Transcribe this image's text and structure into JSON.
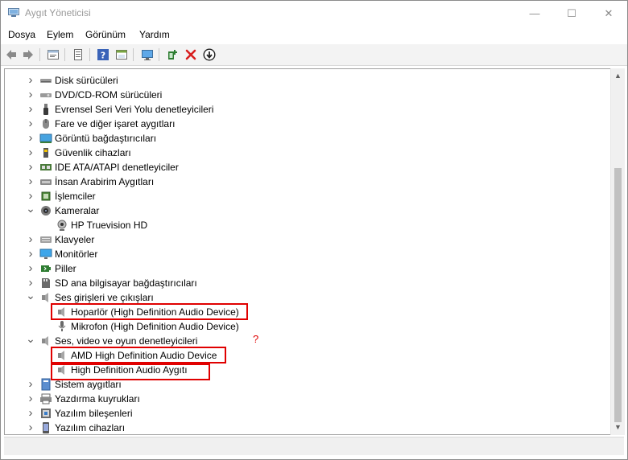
{
  "window": {
    "title": "Aygıt Yöneticisi"
  },
  "title_buttons": {
    "minimize": "—",
    "maximize": "☐",
    "close": "✕"
  },
  "menu": [
    "Dosya",
    "Eylem",
    "Görünüm",
    "Yardım"
  ],
  "toolbar": [
    "back-icon",
    "forward-icon",
    "properties-icon",
    "update-driver-icon",
    "help-icon",
    "view-icon",
    "monitor-icon",
    "add-driver-icon",
    "uninstall-icon",
    "download-icon"
  ],
  "tree": [
    {
      "label": "Disk sürücüleri",
      "icon": "disk-drive-icon",
      "expanded": false,
      "level": 0
    },
    {
      "label": "DVD/CD-ROM sürücüleri",
      "icon": "dvd-drive-icon",
      "expanded": false,
      "level": 0
    },
    {
      "label": "Evrensel Seri Veri Yolu denetleyicileri",
      "icon": "usb-icon",
      "expanded": false,
      "level": 0
    },
    {
      "label": "Fare ve diğer işaret aygıtları",
      "icon": "mouse-icon",
      "expanded": false,
      "level": 0
    },
    {
      "label": "Görüntü bağdaştırıcıları",
      "icon": "display-adapter-icon",
      "expanded": false,
      "level": 0
    },
    {
      "label": "Güvenlik cihazları",
      "icon": "security-device-icon",
      "expanded": false,
      "level": 0
    },
    {
      "label": "IDE ATA/ATAPI denetleyiciler",
      "icon": "ide-controller-icon",
      "expanded": false,
      "level": 0
    },
    {
      "label": "İnsan Arabirim Aygıtları",
      "icon": "hid-icon",
      "expanded": false,
      "level": 0
    },
    {
      "label": "İşlemciler",
      "icon": "processor-icon",
      "expanded": false,
      "level": 0
    },
    {
      "label": "Kameralar",
      "icon": "camera-icon",
      "expanded": true,
      "level": 0
    },
    {
      "label": "HP Truevision HD",
      "icon": "webcam-icon",
      "level": 1
    },
    {
      "label": "Klavyeler",
      "icon": "keyboard-icon",
      "expanded": false,
      "level": 0
    },
    {
      "label": "Monitörler",
      "icon": "monitor-icon",
      "expanded": false,
      "level": 0
    },
    {
      "label": "Piller",
      "icon": "battery-icon",
      "expanded": false,
      "level": 0
    },
    {
      "label": "SD ana bilgisayar bağdaştırıcıları",
      "icon": "sd-host-icon",
      "expanded": false,
      "level": 0
    },
    {
      "label": "Ses girişleri ve çıkışları",
      "icon": "speaker-icon",
      "expanded": true,
      "level": 0
    },
    {
      "label": "Hoparlör (High Definition Audio Device)",
      "icon": "speaker-icon",
      "level": 1,
      "highlighted": true
    },
    {
      "label": "Mikrofon (High Definition Audio Device)",
      "icon": "microphone-icon",
      "level": 1
    },
    {
      "label": "Ses, video ve oyun denetleyicileri",
      "icon": "speaker-icon",
      "expanded": true,
      "level": 0
    },
    {
      "label": "AMD High Definition Audio Device",
      "icon": "speaker-icon",
      "level": 1,
      "highlighted": true
    },
    {
      "label": "High Definition Audio Aygıtı",
      "icon": "speaker-icon",
      "level": 1,
      "highlighted": true
    },
    {
      "label": "Sistem aygıtları",
      "icon": "system-device-icon",
      "expanded": false,
      "level": 0
    },
    {
      "label": "Yazdırma kuyrukları",
      "icon": "print-queue-icon",
      "expanded": false,
      "level": 0
    },
    {
      "label": "Yazılım bileşenleri",
      "icon": "software-component-icon",
      "expanded": false,
      "level": 0
    },
    {
      "label": "Yazılım cihazları",
      "icon": "software-device-icon",
      "expanded": false,
      "level": 0
    }
  ],
  "annotation": "?",
  "colors": {
    "highlight_border": "#e00000"
  }
}
